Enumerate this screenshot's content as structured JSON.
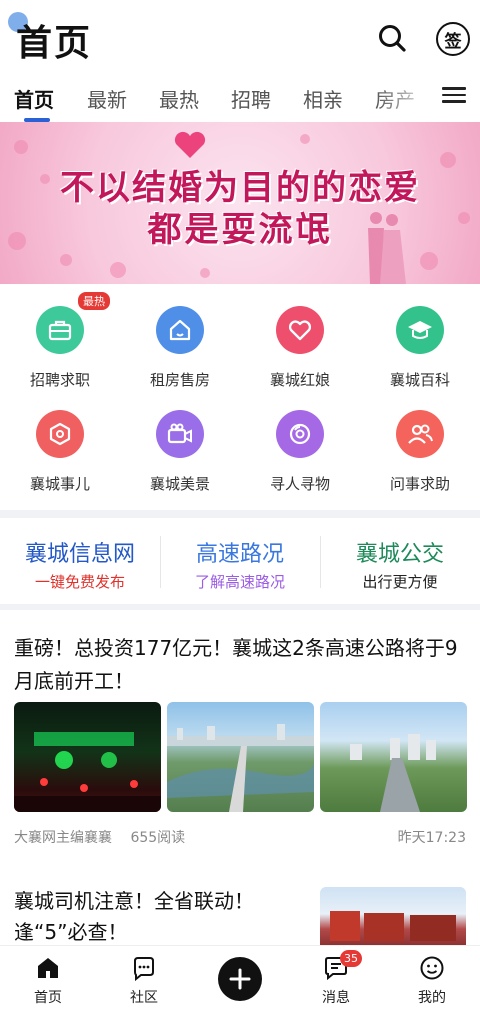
{
  "header": {
    "title": "首页",
    "sign_label": "签"
  },
  "tabs": [
    "首页",
    "最新",
    "最热",
    "招聘",
    "相亲",
    "房产"
  ],
  "banner": {
    "line1": "不以结婚为目的的恋爱",
    "line2": "都是耍流氓"
  },
  "categories": [
    {
      "label": "招聘求职",
      "icon": "briefcase-icon",
      "color": "#3ec99a",
      "badge": "最热"
    },
    {
      "label": "租房售房",
      "icon": "house-icon",
      "color": "#4f8fe8"
    },
    {
      "label": "襄城红娘",
      "icon": "heart-icon",
      "color": "#ee4f6c"
    },
    {
      "label": "襄城百科",
      "icon": "graduation-cap-icon",
      "color": "#34c28c"
    },
    {
      "label": "襄城事儿",
      "icon": "hexagon-icon",
      "color": "#f06060"
    },
    {
      "label": "襄城美景",
      "icon": "camera-icon",
      "color": "#9a6ee8"
    },
    {
      "label": "寻人寻物",
      "icon": "lens-icon",
      "color": "#a569e6"
    },
    {
      "label": "问事求助",
      "icon": "people-icon",
      "color": "#f4645c"
    }
  ],
  "quick_links": [
    {
      "title": "襄城信息网",
      "subtitle": "一键免费发布",
      "title_color": "#2458c8",
      "subtitle_color": "#e0322c"
    },
    {
      "title": "高速路况",
      "subtitle": "了解高速路况",
      "title_color": "#3a78e0",
      "subtitle_color": "#9b5de5"
    },
    {
      "title": "襄城公交",
      "subtitle": "出行更方便",
      "title_color": "#1e8a5a",
      "subtitle_color": "#222222"
    }
  ],
  "article1": {
    "title": "重磅！总投资177亿元！襄城这2条高速公路将于9月底前开工！",
    "author": "大襄网主编襄襄",
    "reads": "655阅读",
    "time": "昨天17:23"
  },
  "article2": {
    "title": "襄城司机注意！全省联动！逢“5”必查！"
  },
  "bottom_nav": [
    {
      "label": "首页",
      "icon": "home-icon"
    },
    {
      "label": "社区",
      "icon": "community-icon"
    },
    {
      "label": "",
      "icon": "plus-icon"
    },
    {
      "label": "消息",
      "icon": "message-icon",
      "badge": "35"
    },
    {
      "label": "我的",
      "icon": "smiley-icon"
    }
  ]
}
